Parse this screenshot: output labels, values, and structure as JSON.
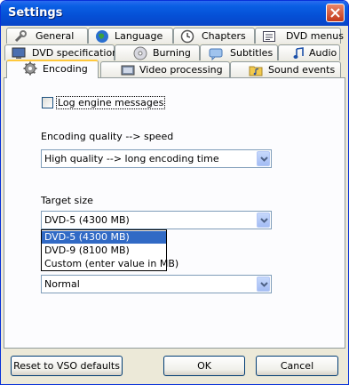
{
  "window": {
    "title": "Settings"
  },
  "tabs": {
    "row1": [
      {
        "label": "General",
        "icon": "wrench-icon"
      },
      {
        "label": "Language",
        "icon": "globe-icon"
      },
      {
        "label": "Chapters",
        "icon": "clock-icon"
      },
      {
        "label": "DVD menus",
        "icon": "menu-icon"
      }
    ],
    "row2": [
      {
        "label": "DVD specification",
        "icon": "monitor-icon"
      },
      {
        "label": "Burning",
        "icon": "disc-icon"
      },
      {
        "label": "Subtitles",
        "icon": "subtitle-icon"
      },
      {
        "label": "Audio",
        "icon": "music-note-icon"
      }
    ],
    "row3": [
      {
        "label": "Encoding",
        "icon": "gear-icon",
        "active": true
      },
      {
        "label": "Video processing",
        "icon": "video-icon"
      },
      {
        "label": "Sound events",
        "icon": "folder-music-icon"
      }
    ]
  },
  "encoding": {
    "log_checkbox_label": "Log engine messages",
    "log_checked": false,
    "quality_label": "Encoding quality --> speed",
    "quality_value": "High quality --> long encoding time",
    "target_label": "Target size",
    "target_value": "DVD-5 (4300 MB)",
    "target_options": [
      "DVD-5 (4300 MB)",
      "DVD-9 (8100 MB)",
      "Custom (enter value in MB)"
    ],
    "priority_value": "Normal"
  },
  "buttons": {
    "reset": "Reset to VSO defaults",
    "ok": "OK",
    "cancel": "Cancel"
  },
  "colors": {
    "titlebar": "#0550d6",
    "selection": "#316ac5",
    "active_tab_accent": "#ffc83c"
  }
}
